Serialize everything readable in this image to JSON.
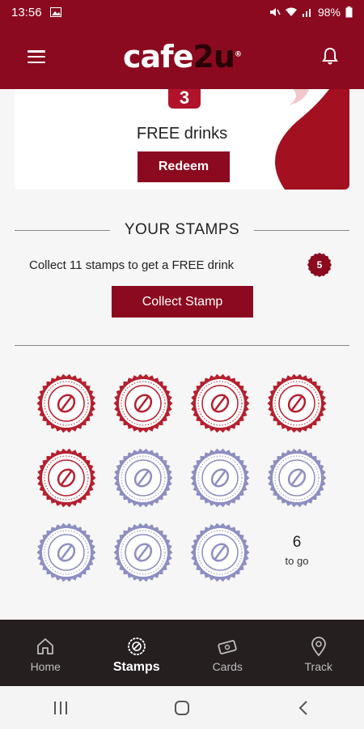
{
  "status_bar": {
    "time": "13:56",
    "battery": "98%"
  },
  "header": {
    "logo_main": "cafe",
    "logo_accent": "2u",
    "logo_mark": "®"
  },
  "promo": {
    "count": "3",
    "title": "FREE drinks",
    "redeem_label": "Redeem"
  },
  "stamps_section": {
    "title": "YOUR STAMPS",
    "collect_text": "Collect 11 stamps to get a FREE drink",
    "count_badge": "5",
    "collect_button": "Collect Stamp",
    "total": 11,
    "collected": 5,
    "to_go_number": "6",
    "to_go_label": "to go"
  },
  "tabs": [
    {
      "label": "Home",
      "icon": "home-icon",
      "active": false
    },
    {
      "label": "Stamps",
      "icon": "stamp-icon",
      "active": true
    },
    {
      "label": "Cards",
      "icon": "card-icon",
      "active": false
    },
    {
      "label": "Track",
      "icon": "location-pin-icon",
      "active": false
    }
  ],
  "colors": {
    "brand": "#8b0a1f",
    "stamp_collected": "#b5202e",
    "stamp_empty": "#8d8fc2",
    "tab_bar": "#251f20"
  }
}
